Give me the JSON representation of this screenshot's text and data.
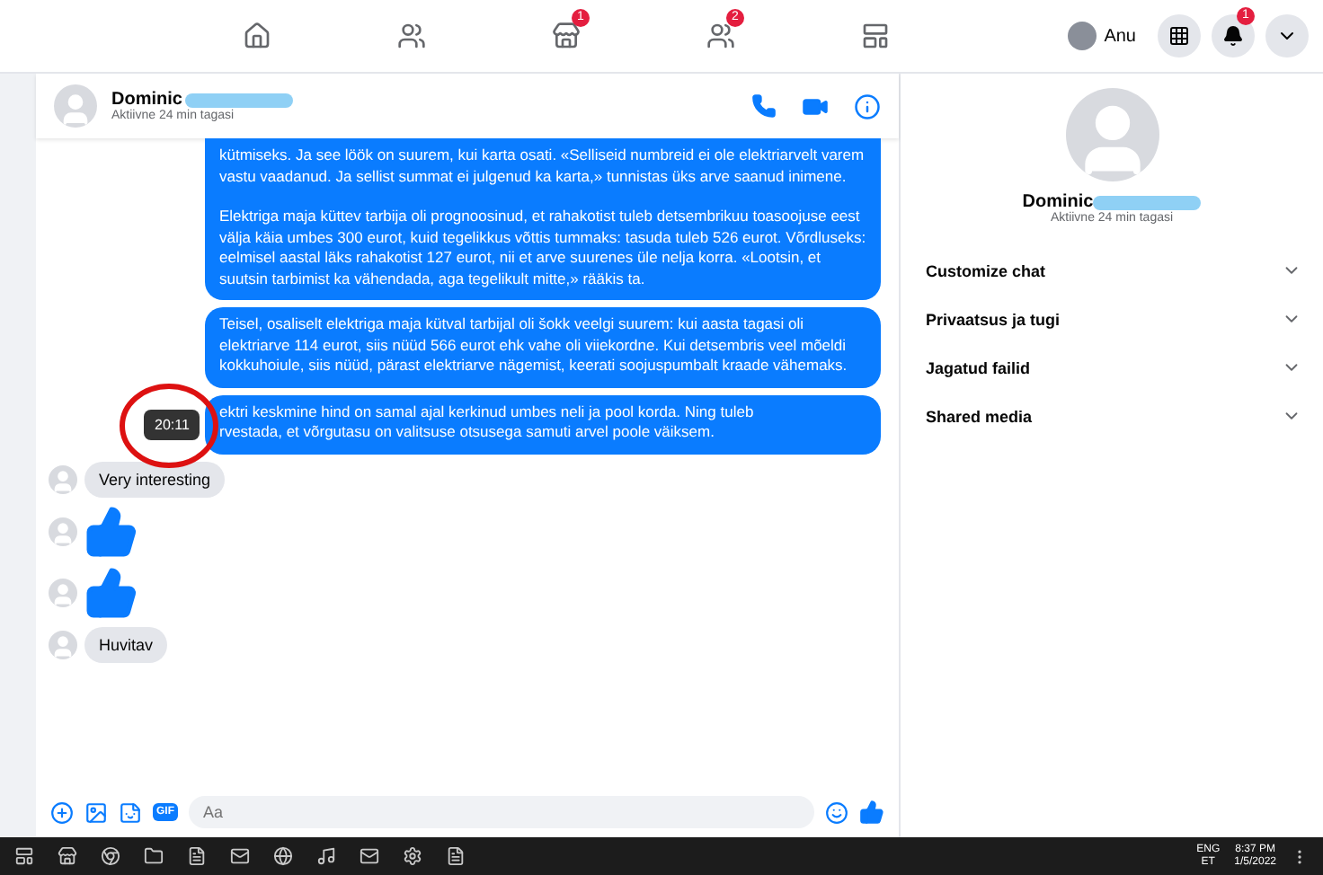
{
  "topbar": {
    "marketplace_badge": "1",
    "groups_badge": "2",
    "user": "Anu",
    "notifications_badge": "1"
  },
  "chat": {
    "name": "Dominic",
    "status": "Aktiivne 24 min tagasi",
    "messages": [
      {
        "kind": "outgoing",
        "paragraphs": [
          "kütmiseks. Ja see löök on suurem, kui karta osati. «Selliseid numbreid ei ole elektriarvelt varem vastu vaadanud. Ja sellist summat ei julgenud ka karta,» tunnistas üks arve saanud inimene.",
          "Elektriga maja küttev tarbija oli prognoosinud, et rahakotist tuleb detsembrikuu toasoojuse eest välja käia umbes 300 eurot, kuid tegelikkus võttis tummaks: tasuda tuleb 526 eurot. Võrdluseks: eelmisel aastal läks rahakotist 127 eurot, nii et arve suurenes üle nelja korra. «Lootsin, et suutsin tarbimist ka vähendada, aga tegelikult mitte,» rääkis ta."
        ]
      },
      {
        "kind": "outgoing",
        "paragraphs": [
          "Teisel, osaliselt elektriga maja kütval tarbijal oli šokk veelgi suurem: kui aasta tagasi oli elektriarve 114 eurot, siis nüüd 566 eurot ehk vahe oli viiekordne. Kui detsembris veel mõeldi kokkuhoiule, siis nüüd, pärast elektriarve nägemist, keerati soojuspumbalt kraade vähemaks."
        ]
      },
      {
        "kind": "outgoing",
        "tooltip": "20:11",
        "lines": [
          "ektri keskmine hind on samal ajal kerkinud umbes neli ja pool korda. Ning tuleb",
          "rvestada, et võrgutasu on valitsuse otsusega samuti arvel poole väiksem."
        ]
      },
      {
        "kind": "incoming",
        "text": "Very interesting"
      },
      {
        "kind": "like"
      },
      {
        "kind": "like"
      },
      {
        "kind": "incoming",
        "text": "Huvitav"
      }
    ],
    "composer": {
      "gif": "GIF",
      "placeholder": "Aa"
    }
  },
  "details": {
    "name": "Dominic",
    "status": "Aktiivne 24 min tagasi",
    "sections": [
      {
        "label": "Customize chat",
        "expanded": false
      },
      {
        "label": "Privaatsus ja tugi",
        "expanded": false
      },
      {
        "label": "Jagatud failid",
        "expanded": false
      },
      {
        "label": "Shared media",
        "expanded": false
      }
    ]
  },
  "taskbar": {
    "language": "ENG",
    "layout": "ET",
    "time": "8:37 PM",
    "date": "1/5/2022"
  }
}
